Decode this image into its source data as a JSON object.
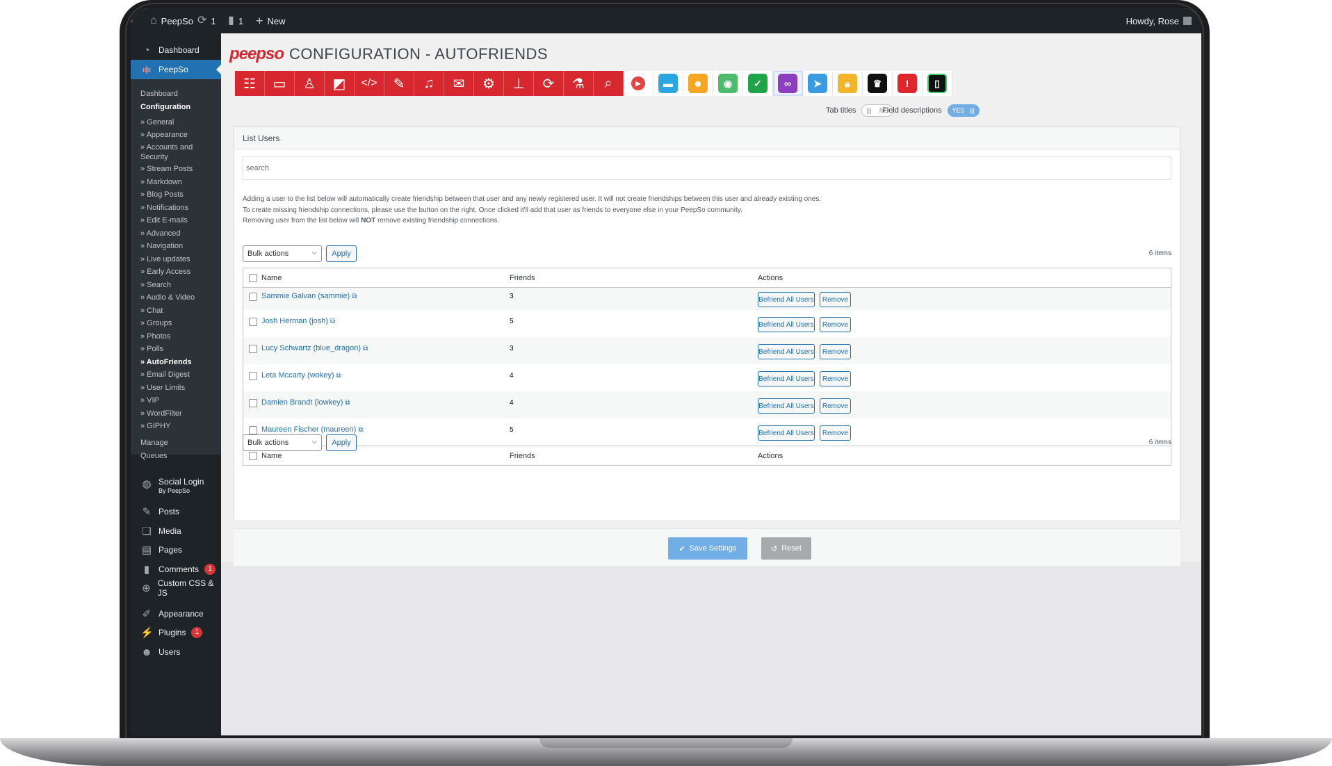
{
  "adminbar": {
    "site_name": "PeepSo",
    "updates_count": "1",
    "comments_count": "1",
    "new_label": "New",
    "howdy": "Howdy, Rose"
  },
  "sidebar": {
    "dashboard": "Dashboard",
    "peepso": "PeepSo",
    "sub_dashboard": "Dashboard",
    "sub_configuration": "Configuration",
    "config_items": [
      "» General",
      "» Appearance",
      "» Accounts and Security",
      "» Stream Posts",
      "» Markdown",
      "» Blog Posts",
      "» Notifications",
      "» Edit E-mails",
      "» Advanced",
      "» Navigation",
      "» Live updates",
      "» Early Access",
      "» Search",
      "» Audio & Video",
      "» Chat",
      "» Groups",
      "» Photos",
      "» Polls",
      "» AutoFriends",
      "» Email Digest",
      "» User Limits",
      "» VIP",
      "» WordFilter",
      "» GIPHY"
    ],
    "manage": "Manage",
    "queues": "Queues",
    "social_login": "Social Login",
    "social_login_sub": "By PeepSo",
    "posts": "Posts",
    "media": "Media",
    "pages": "Pages",
    "comments": "Comments",
    "comments_badge": "1",
    "custom_css": "Custom CSS & JS",
    "appearance": "Appearance",
    "plugins": "Plugins",
    "plugins_badge": "1",
    "users": "Users"
  },
  "header": {
    "logo": "peepso",
    "title": "CONFIGURATION - AUTOFRIENDS"
  },
  "toggles": {
    "tab_titles_label": "Tab titles",
    "tab_titles_value": "NO",
    "field_desc_label": "Field descriptions",
    "field_desc_value": "YES"
  },
  "panel": {
    "title": "List Users",
    "search_placeholder": "search",
    "desc_line1": "Adding a user to the list below will automatically create friendship between that user and any newly registered user. It will not create friendships between this user and already existing ones.",
    "desc_line2": "To create missing friendship connections, please use the button on the right. Once clicked it'll add that user as friends to everyone else in your PeepSo community.",
    "desc_line3_a": "Removing user from the list below will ",
    "desc_line3_b": "NOT",
    "desc_line3_c": " remove existing friendship connections.",
    "bulk_label": "Bulk actions",
    "apply_label": "Apply",
    "items_count": "6 items",
    "col_name": "Name",
    "col_friends": "Friends",
    "col_actions": "Actions",
    "befriend_label": "Befriend All Users",
    "remove_label": "Remove",
    "rows": [
      {
        "name": "Sammie Galvan (sammie)",
        "friends": "3"
      },
      {
        "name": "Josh Herman (josh)",
        "friends": "5"
      },
      {
        "name": "Lucy Schwartz (blue_dragon)",
        "friends": "3"
      },
      {
        "name": "Leta Mccarty (wokey)",
        "friends": "4"
      },
      {
        "name": "Damien Brandt (lowkey)",
        "friends": "4"
      },
      {
        "name": "Maureen Fischer (maureen)",
        "friends": "5"
      }
    ]
  },
  "actions": {
    "save_label": "Save Settings",
    "reset_label": "Reset"
  },
  "colors": {
    "peepso_red": "#d7282f",
    "wp_blue": "#2271b1",
    "admin_dark": "#1d2327"
  }
}
